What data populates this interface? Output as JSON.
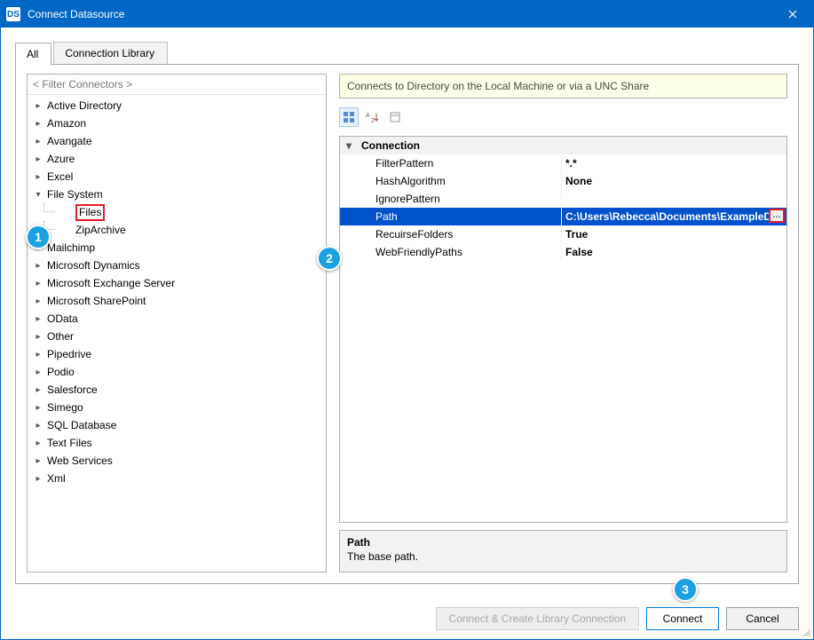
{
  "window": {
    "title": "Connect Datasource",
    "app_icon_text": "DS"
  },
  "tabs": {
    "all": "All",
    "library": "Connection Library"
  },
  "filter_placeholder": "< Filter Connectors >",
  "tree": {
    "items": [
      {
        "label": "Active Directory",
        "expandable": true
      },
      {
        "label": "Amazon",
        "expandable": true
      },
      {
        "label": "Avangate",
        "expandable": true
      },
      {
        "label": "Azure",
        "expandable": true
      },
      {
        "label": "Excel",
        "expandable": true
      },
      {
        "label": "File System",
        "expandable": true,
        "expanded": true,
        "children": [
          {
            "label": "Files",
            "highlighted": true
          },
          {
            "label": "ZipArchive"
          }
        ]
      },
      {
        "label": "Mailchimp",
        "expandable": true
      },
      {
        "label": "Microsoft Dynamics",
        "expandable": true
      },
      {
        "label": "Microsoft Exchange Server",
        "expandable": true
      },
      {
        "label": "Microsoft SharePoint",
        "expandable": true
      },
      {
        "label": "OData",
        "expandable": true
      },
      {
        "label": "Other",
        "expandable": true
      },
      {
        "label": "Pipedrive",
        "expandable": true
      },
      {
        "label": "Podio",
        "expandable": true
      },
      {
        "label": "Salesforce",
        "expandable": true
      },
      {
        "label": "Simego",
        "expandable": true
      },
      {
        "label": "SQL Database",
        "expandable": true
      },
      {
        "label": "Text Files",
        "expandable": true
      },
      {
        "label": "Web Services",
        "expandable": true
      },
      {
        "label": "Xml",
        "expandable": true
      }
    ]
  },
  "info_strip": "Connects to Directory on the Local Machine or via a UNC Share",
  "prop_grid": {
    "category_label": "Connection",
    "rows": [
      {
        "name": "FilterPattern",
        "value": "*.*"
      },
      {
        "name": "HashAlgorithm",
        "value": "None"
      },
      {
        "name": "IgnorePattern",
        "value": ""
      },
      {
        "name": "Path",
        "value": "C:\\Users\\Rebecca\\Documents\\ExampleD",
        "selected": true,
        "has_ellipsis": true
      },
      {
        "name": "RecuirseFolders",
        "value": "True"
      },
      {
        "name": "WebFriendlyPaths",
        "value": "False"
      }
    ]
  },
  "description": {
    "title": "Path",
    "text": "The base path."
  },
  "buttons": {
    "create_lib": "Connect & Create Library Connection",
    "connect": "Connect",
    "cancel": "Cancel"
  },
  "callouts": {
    "c1": "1",
    "c2": "2",
    "c3": "3"
  }
}
